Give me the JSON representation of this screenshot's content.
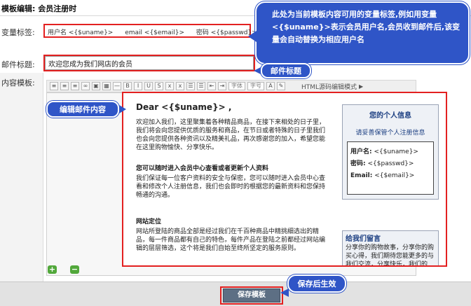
{
  "page": {
    "title": "模板编辑: 会员注册时"
  },
  "variables": {
    "label": "变量标签:",
    "items": [
      "用户名 <{$uname}>",
      "email <{$email}>",
      "密码 <{$passwd}>"
    ]
  },
  "subject": {
    "label": "邮件标题:",
    "value": "欢迎您成为我们网店的会员"
  },
  "content": {
    "label": "内容模板:",
    "toolbar": {
      "font_select": "字体",
      "size_select": "字号",
      "html_source": "HTML源码编辑模式"
    },
    "doc": {
      "greeting": "Dear <{$uname}> ,",
      "intro": "欢迎加入我们，这里聚集着各种精品商品，在接下来相处的日子里，我们将会向您提供优质的服务和商品，在节日或者特殊的日子里我们也会向您提供各种资讯以及精美礼品，再次感谢您的加入，希望您能在这里购物愉快、分享快乐。",
      "section1_title": "您可以随时进入会员中心查看或者更新个人资料",
      "section1_text": "我们保证每一位客户资料的安全与保密，您可以随时进入会员中心查看和修改个人注册信息，我们也会即时的根据您的最新资料和您保持畅通的沟通。",
      "section2_title": "网站定位",
      "section2_text": "网站所登陆的商品全部是经过我们在千百种商品中精挑细选出的精品，每一件商品都有自己的特色，每件产品在登陆之前都经过网站编辑的层层筛选，这个将是我们自始至终所坚定的服务原则。",
      "info_title": "您的个人信息",
      "info_link": "请妥善保管个人注册信息",
      "info_fields": [
        {
          "label": "用户名:",
          "value": "<{$uname}>"
        },
        {
          "label": "密码:",
          "value": "<{$passwd}>"
        },
        {
          "label": "Email:",
          "value": "<{$email}>"
        }
      ],
      "message_title": "给我们留言",
      "message_text": "分享你的购物故事，分享你的购买心得，我们期待您能更多的与我们交流，分享快乐，我们的"
    }
  },
  "actions": {
    "save_label": "保存模板"
  },
  "callouts": {
    "variables": "此处为当前模板内容可用的变量标签,例如用变量<{$uname}>表示会员用户名,会员收到邮件后,该变量会自动替换为相应用户名",
    "subject": "邮件标题",
    "editor": "编辑邮件内容",
    "save": "保存后生效"
  },
  "colors": {
    "callout": "#2f55c7",
    "highlight": "#e32020",
    "save_button": "#5d6f84",
    "link": "#1a3d80"
  }
}
